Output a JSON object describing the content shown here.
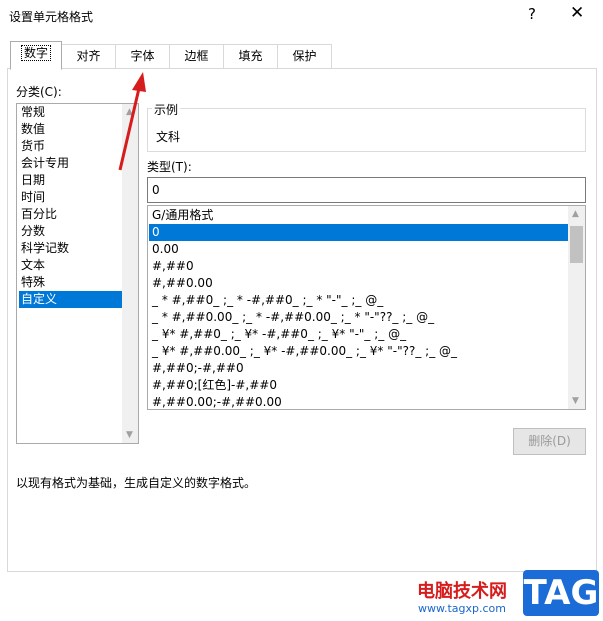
{
  "window": {
    "title": "设置单元格格式",
    "help_label": "?",
    "close_label": "✕"
  },
  "tabs": [
    {
      "label": "数字"
    },
    {
      "label": "对齐"
    },
    {
      "label": "字体"
    },
    {
      "label": "边框"
    },
    {
      "label": "填充"
    },
    {
      "label": "保护"
    }
  ],
  "category": {
    "label": "分类(C):",
    "items": [
      "常规",
      "数值",
      "货币",
      "会计专用",
      "日期",
      "时间",
      "百分比",
      "分数",
      "科学记数",
      "文本",
      "特殊",
      "自定义"
    ],
    "selected": "自定义"
  },
  "sample": {
    "legend": "示例",
    "value": "文科"
  },
  "type": {
    "label": "类型(T):",
    "value": "0"
  },
  "formats": {
    "items": [
      "G/通用格式",
      "0",
      "0.00",
      "#,##0",
      "#,##0.00",
      "_ * #,##0_ ;_ * -#,##0_ ;_ * \"-\"_ ;_ @_",
      "_ * #,##0.00_ ;_ * -#,##0.00_ ;_ * \"-\"??_ ;_ @_",
      "_ ¥* #,##0_ ;_ ¥* -#,##0_ ;_ ¥* \"-\"_ ;_ @_",
      "_ ¥* #,##0.00_ ;_ ¥* -#,##0.00_ ;_ ¥* \"-\"??_ ;_ @_",
      "#,##0;-#,##0",
      "#,##0;[红色]-#,##0",
      "#,##0.00;-#,##0.00"
    ],
    "selected": "0"
  },
  "delete_button": "删除(D)",
  "description": "以现有格式为基础，生成自定义的数字格式。",
  "watermark": {
    "site_name": "电脑技术网",
    "url": "www.tagxp.com",
    "badge": "TAG"
  },
  "colors": {
    "selection": "#0078d7",
    "arrow": "#d61c1c",
    "badge": "#1b6cd6"
  }
}
